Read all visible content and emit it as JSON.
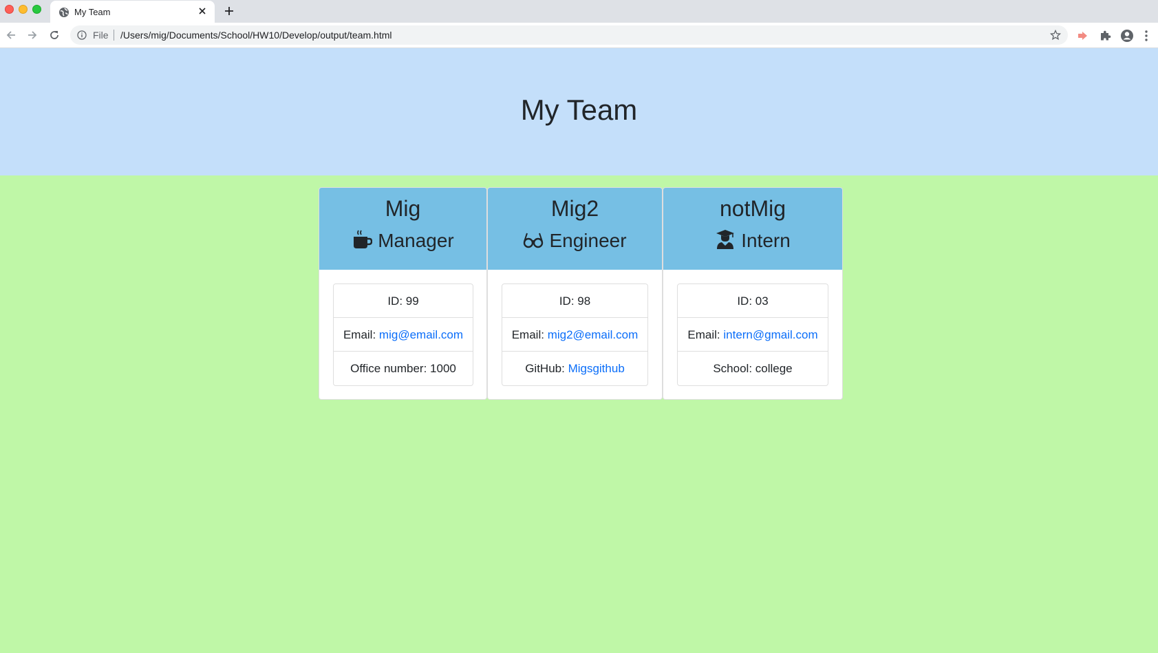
{
  "browser": {
    "tab_title": "My Team",
    "file_label": "File",
    "url": "/Users/mig/Documents/School/HW10/Develop/output/team.html"
  },
  "page": {
    "title": "My Team",
    "colors": {
      "header_bg": "#c4dffa",
      "body_bg": "#bff7a7",
      "card_header_bg": "#76bfe4",
      "link": "#0b6ef9"
    }
  },
  "cards": [
    {
      "name": "Mig",
      "role": "Manager",
      "icon": "mug-icon",
      "id_label": "ID: 99",
      "email_prefix": "Email: ",
      "email": "mig@email.com",
      "extra_text": "Office number: 1000"
    },
    {
      "name": "Mig2",
      "role": "Engineer",
      "icon": "glasses-icon",
      "id_label": "ID: 98",
      "email_prefix": "Email: ",
      "email": "mig2@email.com",
      "extra_prefix": "GitHub: ",
      "extra_link": "Migsgithub"
    },
    {
      "name": "notMig",
      "role": "Intern",
      "icon": "graduate-icon",
      "id_label": "ID: 03",
      "email_prefix": "Email: ",
      "email": "intern@gmail.com",
      "extra_text": "School: college"
    }
  ]
}
